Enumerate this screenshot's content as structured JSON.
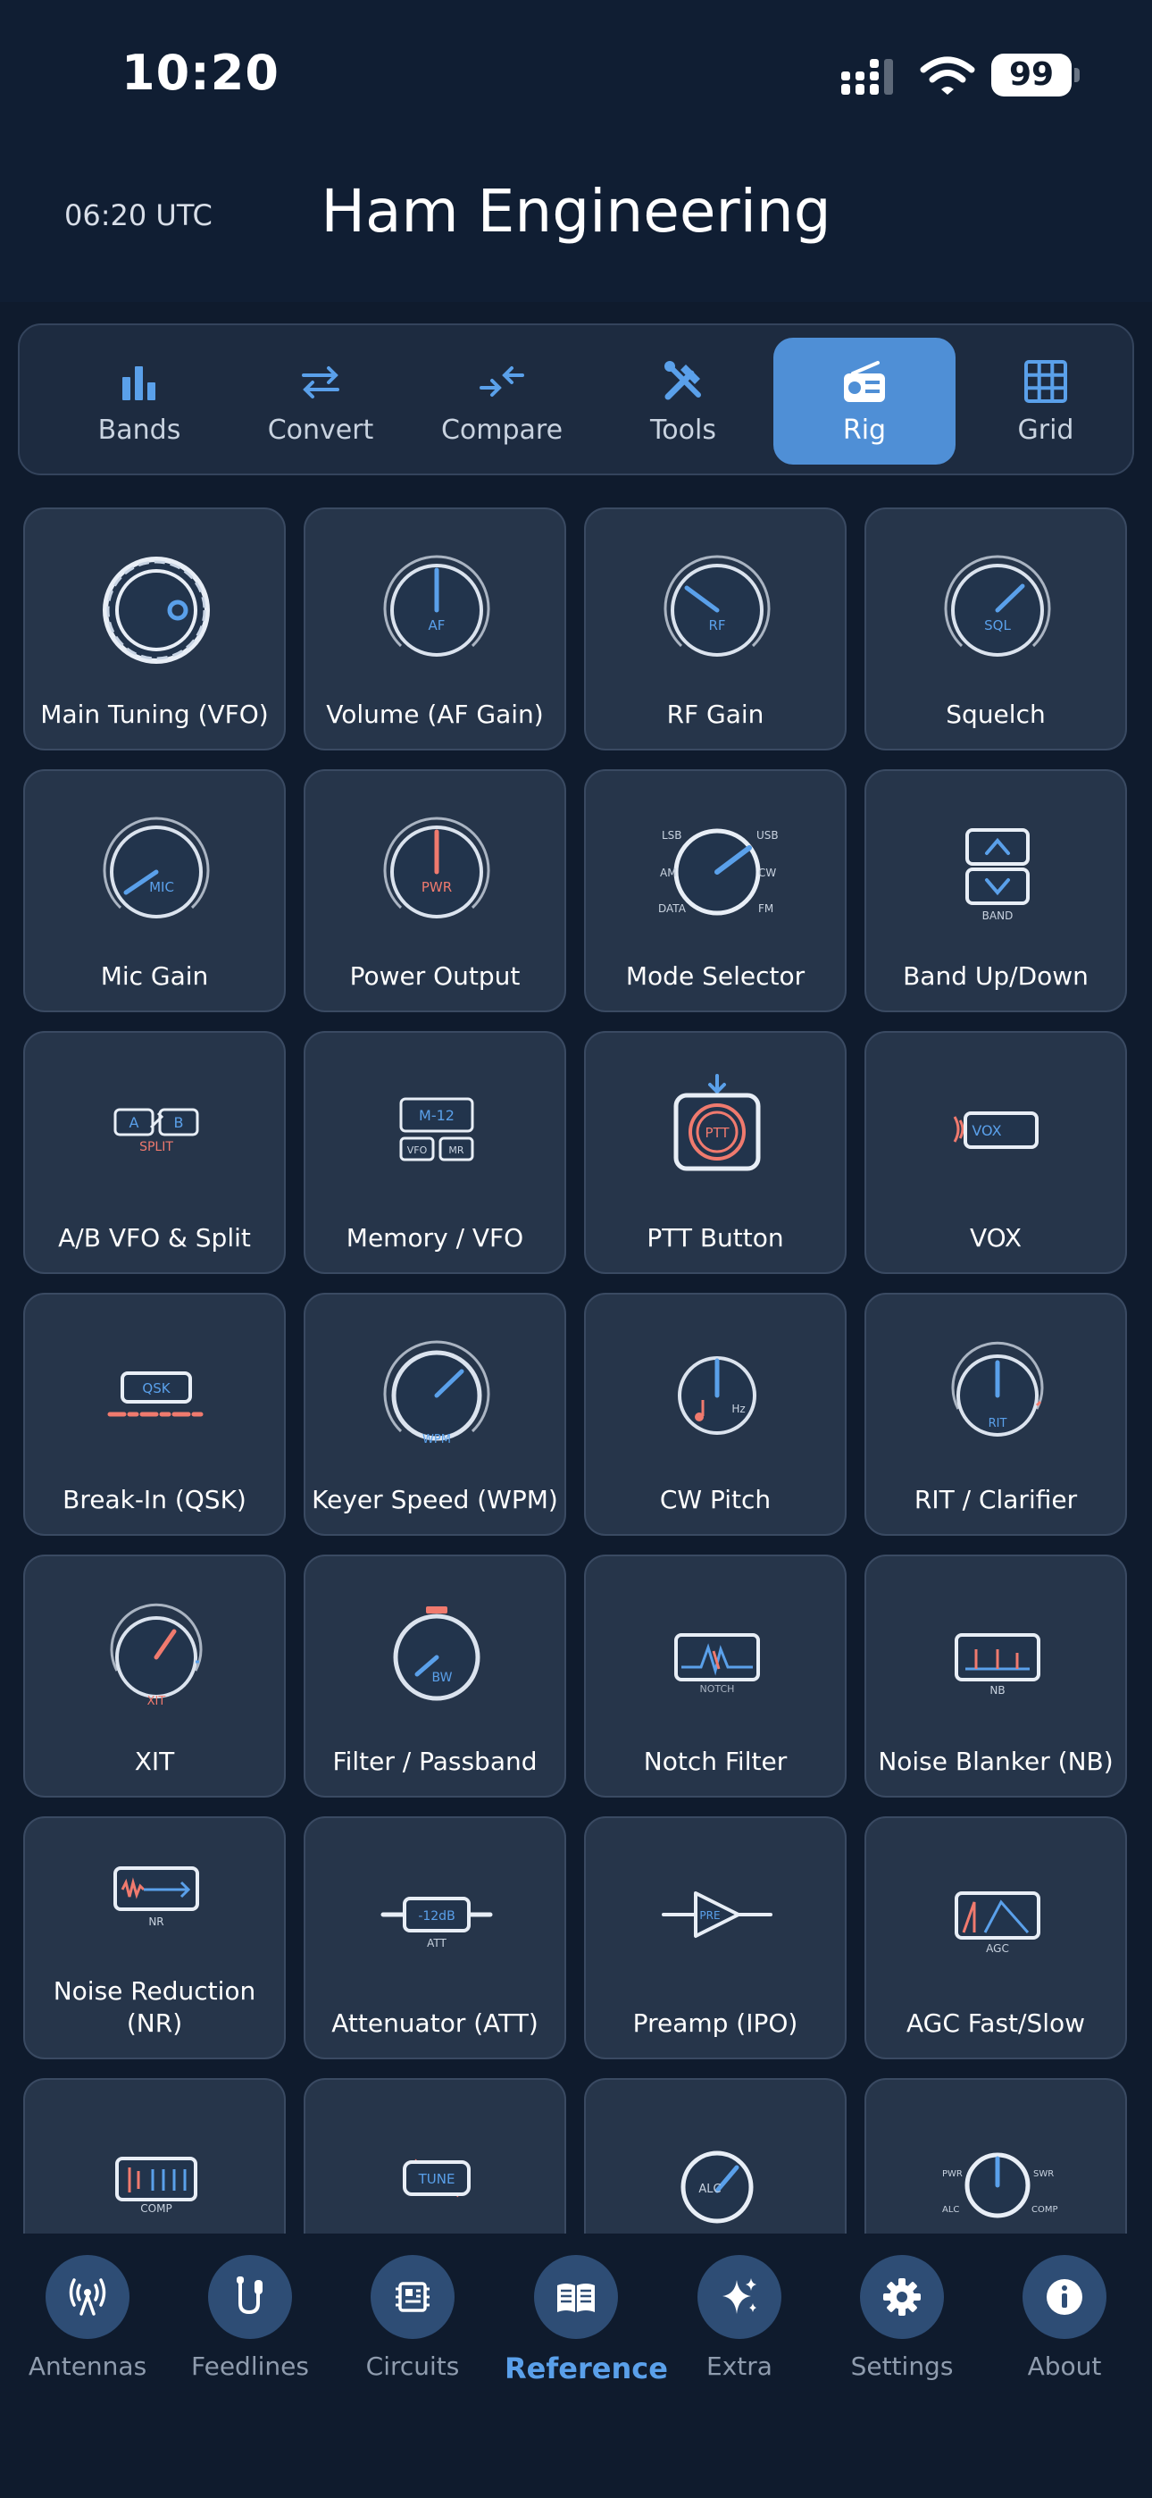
{
  "status_bar": {
    "time": "10:20",
    "battery": "99"
  },
  "header": {
    "utc_time": "06:20 UTC",
    "title": "Ham Engineering"
  },
  "tabs": [
    {
      "label": "Bands",
      "icon": "bar-chart-icon"
    },
    {
      "label": "Convert",
      "icon": "swap-arrows-icon"
    },
    {
      "label": "Compare",
      "icon": "compare-arrows-icon"
    },
    {
      "label": "Tools",
      "icon": "tools-icon"
    },
    {
      "label": "Rig",
      "icon": "radio-icon",
      "active": true
    },
    {
      "label": "Grid",
      "icon": "grid-icon"
    }
  ],
  "tiles": [
    {
      "caption": "Main Tuning (VFO)",
      "icon": "vfo-knob-icon"
    },
    {
      "caption": "Volume (AF Gain)",
      "icon": "af-knob-icon",
      "text": "AF"
    },
    {
      "caption": "RF Gain",
      "icon": "rf-knob-icon",
      "text": "RF"
    },
    {
      "caption": "Squelch",
      "icon": "sql-knob-icon",
      "text": "SQL"
    },
    {
      "caption": "Mic Gain",
      "icon": "mic-knob-icon",
      "text": "MIC"
    },
    {
      "caption": "Power Output",
      "icon": "pwr-knob-icon",
      "text": "PWR"
    },
    {
      "caption": "Mode Selector",
      "icon": "mode-knob-icon",
      "labels": [
        "LSB",
        "USB",
        "AM",
        "CW",
        "DATA",
        "FM"
      ]
    },
    {
      "caption": "Band Up/Down",
      "icon": "band-updown-icon",
      "text": "BAND"
    },
    {
      "caption": "A/B VFO & Split",
      "icon": "ab-split-icon",
      "labels": [
        "A",
        "B",
        "SPLIT"
      ]
    },
    {
      "caption": "Memory / VFO",
      "icon": "memory-icon",
      "labels": [
        "M-12",
        "VFO",
        "MR"
      ]
    },
    {
      "caption": "PTT Button",
      "icon": "ptt-icon",
      "text": "PTT"
    },
    {
      "caption": "VOX",
      "icon": "vox-icon",
      "text": "VOX"
    },
    {
      "caption": "Break-In (QSK)",
      "icon": "qsk-icon",
      "text": "QSK"
    },
    {
      "caption": "Keyer Speed (WPM)",
      "icon": "wpm-knob-icon",
      "text": "WPM"
    },
    {
      "caption": "CW Pitch",
      "icon": "cw-pitch-icon",
      "text": "Hz"
    },
    {
      "caption": "RIT / Clarifier",
      "icon": "rit-knob-icon",
      "text": "RIT"
    },
    {
      "caption": "XIT",
      "icon": "xit-knob-icon",
      "text": "XIT"
    },
    {
      "caption": "Filter / Passband",
      "icon": "filter-knob-icon",
      "text": "BW"
    },
    {
      "caption": "Notch Filter",
      "icon": "notch-icon",
      "text": "NOTCH"
    },
    {
      "caption": "Noise Blanker (NB)",
      "icon": "nb-icon",
      "text": "NB"
    },
    {
      "caption": "Noise Reduction (NR)",
      "icon": "nr-icon",
      "text": "NR"
    },
    {
      "caption": "Attenuator (ATT)",
      "icon": "att-icon",
      "labels": [
        "-12dB",
        "ATT"
      ]
    },
    {
      "caption": "Preamp (IPO)",
      "icon": "preamp-icon",
      "text": "PRE"
    },
    {
      "caption": "AGC Fast/Slow",
      "icon": "agc-icon",
      "text": "AGC"
    },
    {
      "caption": "",
      "icon": "comp-icon",
      "text": "COMP"
    },
    {
      "caption": "",
      "icon": "tune-icon",
      "text": "TUNE"
    },
    {
      "caption": "",
      "icon": "alc-knob-icon",
      "text": "ALC"
    },
    {
      "caption": "",
      "icon": "meter-knob-icon",
      "labels": [
        "PWR",
        "SWR",
        "ALC",
        "COMP"
      ]
    }
  ],
  "bottom_nav": [
    {
      "label": "Antennas",
      "icon": "antenna-icon"
    },
    {
      "label": "Feedlines",
      "icon": "feedline-icon"
    },
    {
      "label": "Circuits",
      "icon": "circuit-icon"
    },
    {
      "label": "Reference",
      "icon": "book-icon",
      "active": true
    },
    {
      "label": "Extra",
      "icon": "sparkles-icon"
    },
    {
      "label": "Settings",
      "icon": "gear-icon"
    },
    {
      "label": "About",
      "icon": "info-icon"
    }
  ],
  "colors": {
    "background": "#0f1b2d",
    "tile": "#26354a",
    "accent": "#4f8fd6",
    "highlight": "#f07a6e",
    "icon_blue": "#5aa0ea"
  }
}
